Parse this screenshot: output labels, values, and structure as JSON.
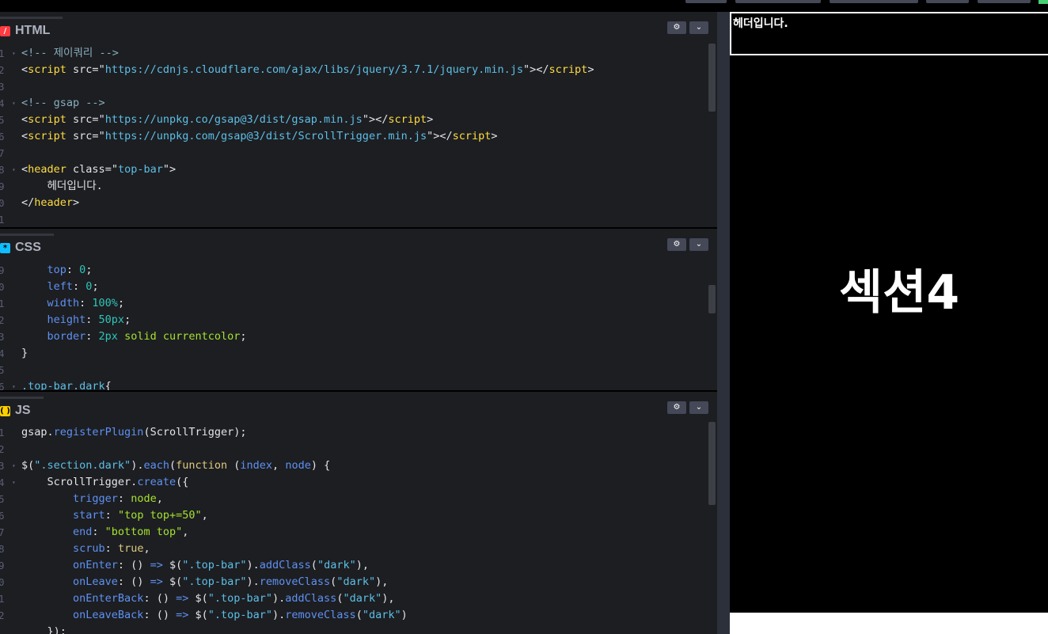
{
  "panels": {
    "html": {
      "title": "HTML",
      "icon": "html-icon",
      "icon_color": "#ff3c41",
      "lines": [
        {
          "n": "1",
          "fold": true,
          "segs": [
            [
              "c-com",
              "<!-- 제이쿼리 -->"
            ]
          ]
        },
        {
          "n": "2",
          "fold": false,
          "segs": [
            [
              "c-p",
              "<"
            ],
            [
              "c-tag",
              "script"
            ],
            [
              "c-attr",
              " src="
            ],
            [
              "c-p",
              "\""
            ],
            [
              "c-url",
              "https://cdnjs.cloudflare.com/ajax/libs/jquery/3.7.1/jquery.min.js"
            ],
            [
              "c-p",
              "\"></"
            ],
            [
              "c-tag",
              "script"
            ],
            [
              "c-p",
              ">"
            ]
          ]
        },
        {
          "n": "3",
          "fold": false,
          "segs": []
        },
        {
          "n": "4",
          "fold": true,
          "segs": [
            [
              "c-com",
              "<!-- gsap -->"
            ]
          ]
        },
        {
          "n": "5",
          "fold": false,
          "segs": [
            [
              "c-p",
              "<"
            ],
            [
              "c-tag",
              "script"
            ],
            [
              "c-attr",
              " src="
            ],
            [
              "c-p",
              "\""
            ],
            [
              "c-url",
              "https://unpkg.co/gsap@3/dist/gsap.min.js"
            ],
            [
              "c-p",
              "\"></"
            ],
            [
              "c-tag",
              "script"
            ],
            [
              "c-p",
              ">"
            ]
          ]
        },
        {
          "n": "6",
          "fold": false,
          "segs": [
            [
              "c-p",
              "<"
            ],
            [
              "c-tag",
              "script"
            ],
            [
              "c-attr",
              " src="
            ],
            [
              "c-p",
              "\""
            ],
            [
              "c-url",
              "https://unpkg.com/gsap@3/dist/ScrollTrigger.min.js"
            ],
            [
              "c-p",
              "\"></"
            ],
            [
              "c-tag",
              "script"
            ],
            [
              "c-p",
              ">"
            ]
          ]
        },
        {
          "n": "7",
          "fold": false,
          "segs": []
        },
        {
          "n": "8",
          "fold": true,
          "segs": [
            [
              "c-p",
              "<"
            ],
            [
              "c-tag",
              "header"
            ],
            [
              "c-attr",
              " class="
            ],
            [
              "c-p",
              "\""
            ],
            [
              "c-url",
              "top-bar"
            ],
            [
              "c-p",
              "\">"
            ]
          ]
        },
        {
          "n": "9",
          "fold": false,
          "segs": [
            [
              "c-p",
              "    헤더입니다."
            ]
          ]
        },
        {
          "n": "0",
          "fold": false,
          "segs": [
            [
              "c-p",
              "</"
            ],
            [
              "c-tag",
              "header"
            ],
            [
              "c-p",
              ">"
            ]
          ]
        },
        {
          "n": "1",
          "fold": false,
          "segs": []
        }
      ]
    },
    "css": {
      "title": "CSS",
      "icon": "css-icon",
      "icon_color": "#0ebeff",
      "lines": [
        {
          "n": "9",
          "fold": false,
          "segs": [
            [
              "c-prop",
              "    top"
            ],
            [
              "c-p",
              ": "
            ],
            [
              "c-num",
              "0"
            ],
            [
              "c-p",
              ";"
            ]
          ]
        },
        {
          "n": "0",
          "fold": false,
          "segs": [
            [
              "c-prop",
              "    left"
            ],
            [
              "c-p",
              ": "
            ],
            [
              "c-num",
              "0"
            ],
            [
              "c-p",
              ";"
            ]
          ]
        },
        {
          "n": "1",
          "fold": false,
          "segs": [
            [
              "c-prop",
              "    width"
            ],
            [
              "c-p",
              ": "
            ],
            [
              "c-num",
              "100%"
            ],
            [
              "c-p",
              ";"
            ]
          ]
        },
        {
          "n": "2",
          "fold": false,
          "segs": [
            [
              "c-prop",
              "    height"
            ],
            [
              "c-p",
              ": "
            ],
            [
              "c-num",
              "50px"
            ],
            [
              "c-p",
              ";"
            ]
          ]
        },
        {
          "n": "3",
          "fold": false,
          "segs": [
            [
              "c-prop",
              "    border"
            ],
            [
              "c-p",
              ": "
            ],
            [
              "c-num",
              "2px"
            ],
            [
              "c-p",
              " "
            ],
            [
              "c-str",
              "solid currentcolor"
            ],
            [
              "c-p",
              ";"
            ]
          ]
        },
        {
          "n": "4",
          "fold": false,
          "segs": [
            [
              "c-p",
              "}"
            ]
          ]
        },
        {
          "n": "5",
          "fold": false,
          "segs": []
        },
        {
          "n": "6",
          "fold": true,
          "segs": [
            [
              "c-sel",
              ".top-bar.dark"
            ],
            [
              "c-p",
              "{"
            ]
          ]
        }
      ]
    },
    "js": {
      "title": "JS",
      "icon": "js-icon",
      "icon_color": "#fcd000",
      "lines": [
        {
          "n": "1",
          "fold": false,
          "segs": [
            [
              "c-p",
              "gsap."
            ],
            [
              "c-fn",
              "registerPlugin"
            ],
            [
              "c-p",
              "(ScrollTrigger);"
            ]
          ]
        },
        {
          "n": "2",
          "fold": false,
          "segs": []
        },
        {
          "n": "3",
          "fold": true,
          "segs": [
            [
              "c-p",
              "$("
            ],
            [
              "c-url",
              "\".section.dark\""
            ],
            [
              "c-p",
              ")."
            ],
            [
              "c-fn",
              "each"
            ],
            [
              "c-p",
              "("
            ],
            [
              "c-kw",
              "function"
            ],
            [
              "c-p",
              " ("
            ],
            [
              "c-prop",
              "index"
            ],
            [
              "c-p",
              ", "
            ],
            [
              "c-prop",
              "node"
            ],
            [
              "c-p",
              ") {"
            ]
          ]
        },
        {
          "n": "4",
          "fold": true,
          "segs": [
            [
              "c-p",
              "    ScrollTrigger."
            ],
            [
              "c-fn",
              "create"
            ],
            [
              "c-p",
              "({"
            ]
          ]
        },
        {
          "n": "5",
          "fold": false,
          "segs": [
            [
              "c-prop",
              "        trigger"
            ],
            [
              "c-p",
              ": "
            ],
            [
              "c-str",
              "node"
            ],
            [
              "c-p",
              ","
            ]
          ]
        },
        {
          "n": "6",
          "fold": false,
          "segs": [
            [
              "c-prop",
              "        start"
            ],
            [
              "c-p",
              ": "
            ],
            [
              "c-str",
              "\"top top+=50\""
            ],
            [
              "c-p",
              ","
            ]
          ]
        },
        {
          "n": "7",
          "fold": false,
          "segs": [
            [
              "c-prop",
              "        end"
            ],
            [
              "c-p",
              ": "
            ],
            [
              "c-str",
              "\"bottom top\""
            ],
            [
              "c-p",
              ","
            ]
          ]
        },
        {
          "n": "8",
          "fold": false,
          "segs": [
            [
              "c-prop",
              "        scrub"
            ],
            [
              "c-p",
              ": "
            ],
            [
              "c-kw",
              "true"
            ],
            [
              "c-p",
              ","
            ]
          ]
        },
        {
          "n": "9",
          "fold": false,
          "segs": [
            [
              "c-prop",
              "        onEnter"
            ],
            [
              "c-p",
              ": () "
            ],
            [
              "c-fn",
              "=>"
            ],
            [
              "c-p",
              " $("
            ],
            [
              "c-url",
              "\".top-bar\""
            ],
            [
              "c-p",
              ")."
            ],
            [
              "c-fn",
              "addClass"
            ],
            [
              "c-p",
              "("
            ],
            [
              "c-url",
              "\"dark\""
            ],
            [
              "c-p",
              "),"
            ]
          ]
        },
        {
          "n": "0",
          "fold": false,
          "segs": [
            [
              "c-prop",
              "        onLeave"
            ],
            [
              "c-p",
              ": () "
            ],
            [
              "c-fn",
              "=>"
            ],
            [
              "c-p",
              " $("
            ],
            [
              "c-url",
              "\".top-bar\""
            ],
            [
              "c-p",
              ")."
            ],
            [
              "c-fn",
              "removeClass"
            ],
            [
              "c-p",
              "("
            ],
            [
              "c-url",
              "\"dark\""
            ],
            [
              "c-p",
              "),"
            ]
          ]
        },
        {
          "n": "1",
          "fold": false,
          "segs": [
            [
              "c-prop",
              "        onEnterBack"
            ],
            [
              "c-p",
              ": () "
            ],
            [
              "c-fn",
              "=>"
            ],
            [
              "c-p",
              " $("
            ],
            [
              "c-url",
              "\".top-bar\""
            ],
            [
              "c-p",
              ")."
            ],
            [
              "c-fn",
              "addClass"
            ],
            [
              "c-p",
              "("
            ],
            [
              "c-url",
              "\"dark\""
            ],
            [
              "c-p",
              "),"
            ]
          ]
        },
        {
          "n": "2",
          "fold": false,
          "segs": [
            [
              "c-prop",
              "        onLeaveBack"
            ],
            [
              "c-p",
              ": () "
            ],
            [
              "c-fn",
              "=>"
            ],
            [
              "c-p",
              " $("
            ],
            [
              "c-url",
              "\".top-bar\""
            ],
            [
              "c-p",
              ")."
            ],
            [
              "c-fn",
              "removeClass"
            ],
            [
              "c-p",
              "("
            ],
            [
              "c-url",
              "\"dark\""
            ],
            [
              "c-p",
              ")"
            ]
          ]
        },
        {
          "n": "",
          "fold": false,
          "segs": [
            [
              "c-p",
              "    });"
            ]
          ]
        }
      ]
    }
  },
  "panel_buttons": {
    "settings": "⚙",
    "collapse": "⌄"
  },
  "preview": {
    "header_text": "헤더입니다.",
    "section_title": "섹션4"
  }
}
